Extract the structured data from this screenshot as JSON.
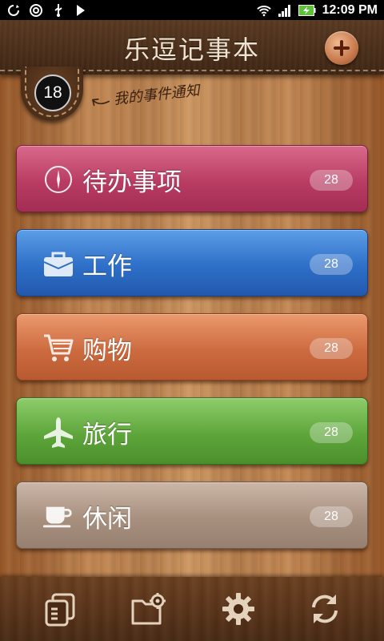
{
  "status_bar": {
    "time": "12:09 PM",
    "icons": [
      "sync-icon",
      "at-icon",
      "usb-icon",
      "play-icon",
      "wifi-icon",
      "signal-icon",
      "battery-charging-icon"
    ]
  },
  "header": {
    "title": "乐逗记事本",
    "add_icon": "plus-icon"
  },
  "notification": {
    "count": "18",
    "hint": "我的事件通知"
  },
  "categories": [
    {
      "label": "待办事项",
      "count": "28",
      "icon": "compass-icon",
      "color": "#c0456b"
    },
    {
      "label": "工作",
      "count": "28",
      "icon": "briefcase-icon",
      "color": "#2e6fc8"
    },
    {
      "label": "购物",
      "count": "28",
      "icon": "cart-icon",
      "color": "#cd6b40"
    },
    {
      "label": "旅行",
      "count": "28",
      "icon": "airplane-icon",
      "color": "#5ea63b"
    },
    {
      "label": "休闲",
      "count": "28",
      "icon": "coffee-cup-icon",
      "color": "#a8907f"
    }
  ],
  "toolbar": {
    "buttons": [
      "notes-list-icon",
      "folder-settings-icon",
      "gear-icon",
      "refresh-icon"
    ]
  }
}
